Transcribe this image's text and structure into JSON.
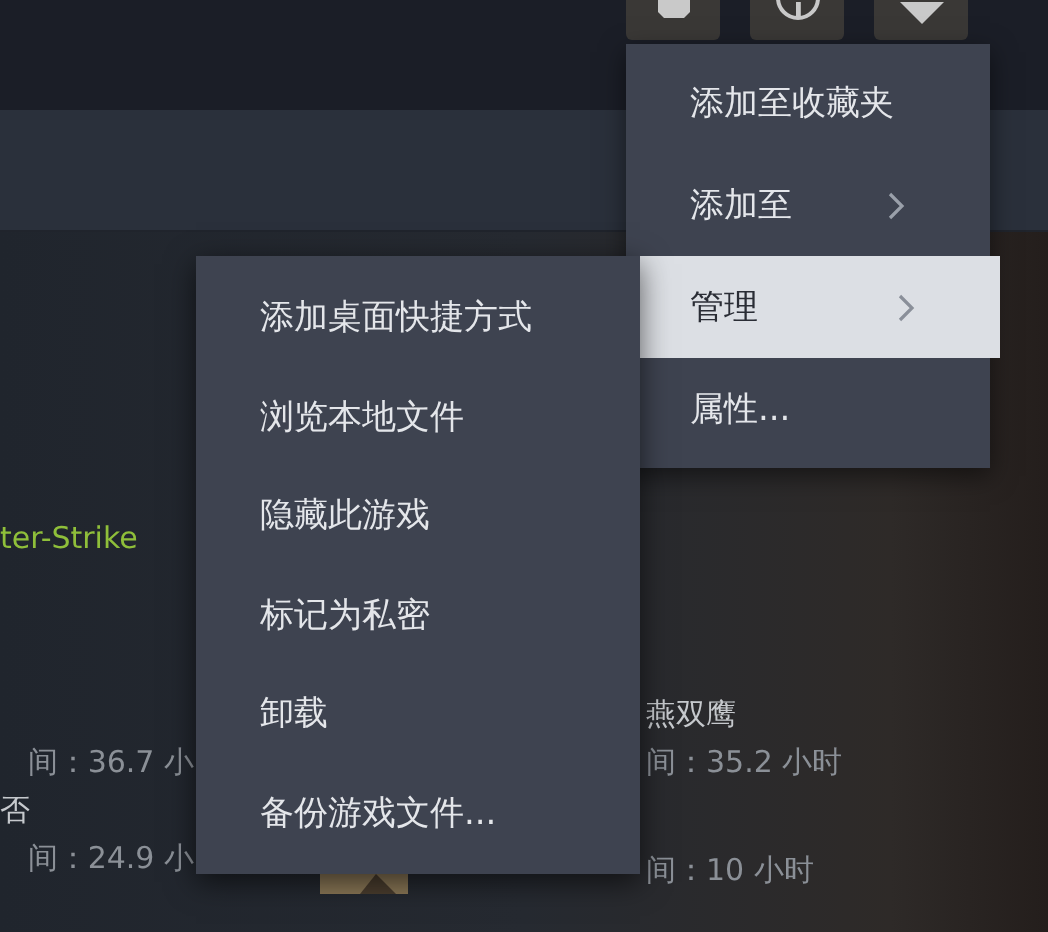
{
  "library": {
    "left": [
      {
        "kind": "game",
        "text": "ter-Strike"
      },
      {
        "kind": "stat",
        "text": "间：36.7 小"
      },
      {
        "kind": "name",
        "text": "否"
      },
      {
        "kind": "stat",
        "text": "间：24.9 小"
      }
    ],
    "right": [
      {
        "kind": "name",
        "text": "燕双鹰"
      },
      {
        "kind": "stat",
        "text": "间：35.2 小时"
      },
      {
        "kind": "stat",
        "text": "间：10 小时"
      }
    ]
  },
  "context_menu": {
    "items": [
      {
        "label": "添加至收藏夹",
        "submenu": false,
        "selected": false
      },
      {
        "label": "添加至",
        "submenu": true,
        "selected": false
      },
      {
        "label": "管理",
        "submenu": true,
        "selected": true
      },
      {
        "label": "属性...",
        "submenu": false,
        "selected": false
      }
    ]
  },
  "submenu": {
    "items": [
      {
        "label": "添加桌面快捷方式"
      },
      {
        "label": "浏览本地文件"
      },
      {
        "label": "隐藏此游戏"
      },
      {
        "label": "标记为私密"
      },
      {
        "label": "卸载"
      },
      {
        "label": "备份游戏文件..."
      }
    ]
  }
}
